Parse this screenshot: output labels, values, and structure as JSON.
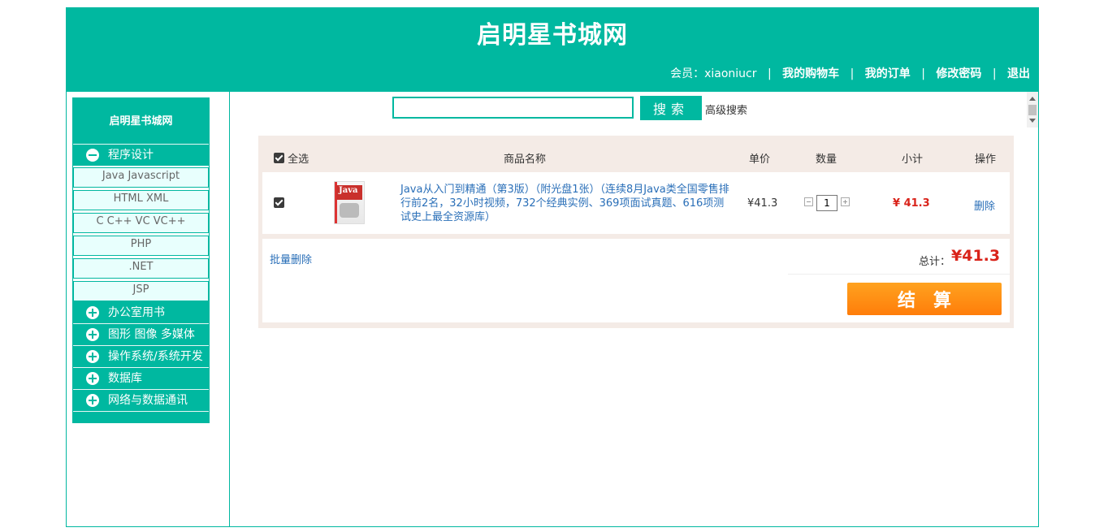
{
  "header": {
    "site_title": "启明星书城网",
    "member_label": "会员：",
    "username": "xiaoniucr",
    "sep": "|",
    "links": {
      "cart": "我的购物车",
      "orders": "我的订单",
      "change_password": "修改密码",
      "logout": "退出"
    }
  },
  "sidebar": {
    "title": "启明星书城网",
    "categories": [
      {
        "label": "程序设计",
        "expanded": true,
        "items": [
          "Java Javascript",
          "HTML XML",
          "C C++ VC VC++",
          "PHP",
          ".NET",
          "JSP"
        ]
      },
      {
        "label": "办公室用书",
        "expanded": false
      },
      {
        "label": "图形 图像 多媒体",
        "expanded": false
      },
      {
        "label": "操作系统/系统开发",
        "expanded": false
      },
      {
        "label": "数据库",
        "expanded": false
      },
      {
        "label": "网络与数据通讯",
        "expanded": false
      }
    ]
  },
  "search": {
    "value": "",
    "button": "搜索",
    "advanced": "高级搜索"
  },
  "cart": {
    "headers": {
      "select_all": "全选",
      "name": "商品名称",
      "price": "单价",
      "quantity": "数量",
      "subtotal": "小计",
      "action": "操作"
    },
    "items": [
      {
        "checked": true,
        "name": "Java从入门到精通（第3版）（附光盘1张）（连续8月Java类全国零售排行前2名，32小时视频，732个经典实例、369项面试真题、616项测试史上最全资源库）",
        "cover_text": "Java",
        "price": "¥41.3",
        "quantity": "1",
        "subtotal": "¥ 41.3",
        "action": "删除"
      }
    ],
    "batch_delete": "批量删除",
    "total_label": "总计：",
    "total_value": "¥41.3",
    "checkout": "结算"
  },
  "colors": {
    "brand": "#00b8a0",
    "price_red": "#d9231a",
    "link_blue": "#2a6fb8",
    "checkout_orange": "#ff8c14"
  }
}
